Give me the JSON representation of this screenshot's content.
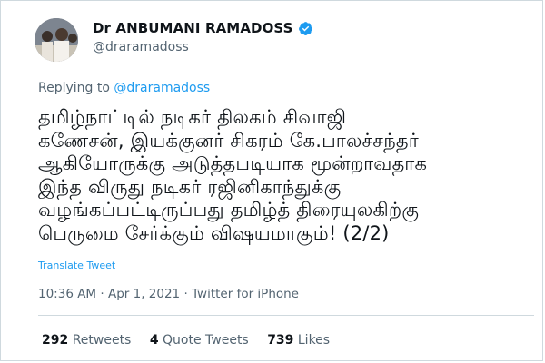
{
  "author": {
    "display_name": "Dr ANBUMANI RAMADOSS",
    "handle": "@draramadoss",
    "verified_icon": "verified-badge-icon",
    "avatar_icon": "profile-photo"
  },
  "reply": {
    "prefix": "Replying to",
    "mention": "@draramadoss"
  },
  "tweet": {
    "lines": [
      "தமிழ்நாட்டில் நடிகர் திலகம் சிவாஜி",
      "கணேசன், இயக்குனர் சிகரம் கே.பாலச்சந்தர்",
      "ஆகியோருக்கு அடுத்தபடியாக மூன்றாவதாக",
      "இந்த விருது நடிகர் ரஜினிகாந்துக்கு",
      "வழங்கப்பட்டிருப்பது தமிழ்த் திரையுலகிற்கு",
      "பெருமை சேர்க்கும் விஷயமாகும்! (2/2)"
    ],
    "translate_label": "Translate Tweet"
  },
  "meta": {
    "time": "10:36 AM",
    "sep1": " · ",
    "date": "Apr 1, 2021",
    "sep2": " · ",
    "source": "Twitter for iPhone"
  },
  "stats": {
    "retweets_count": "292",
    "retweets_label": "Retweets",
    "quotes_count": "4",
    "quotes_label": "Quote Tweets",
    "likes_count": "739",
    "likes_label": "Likes"
  },
  "colors": {
    "link": "#1d9bf0",
    "muted": "#536471",
    "text": "#0f1419",
    "divider": "#cfd9de"
  }
}
